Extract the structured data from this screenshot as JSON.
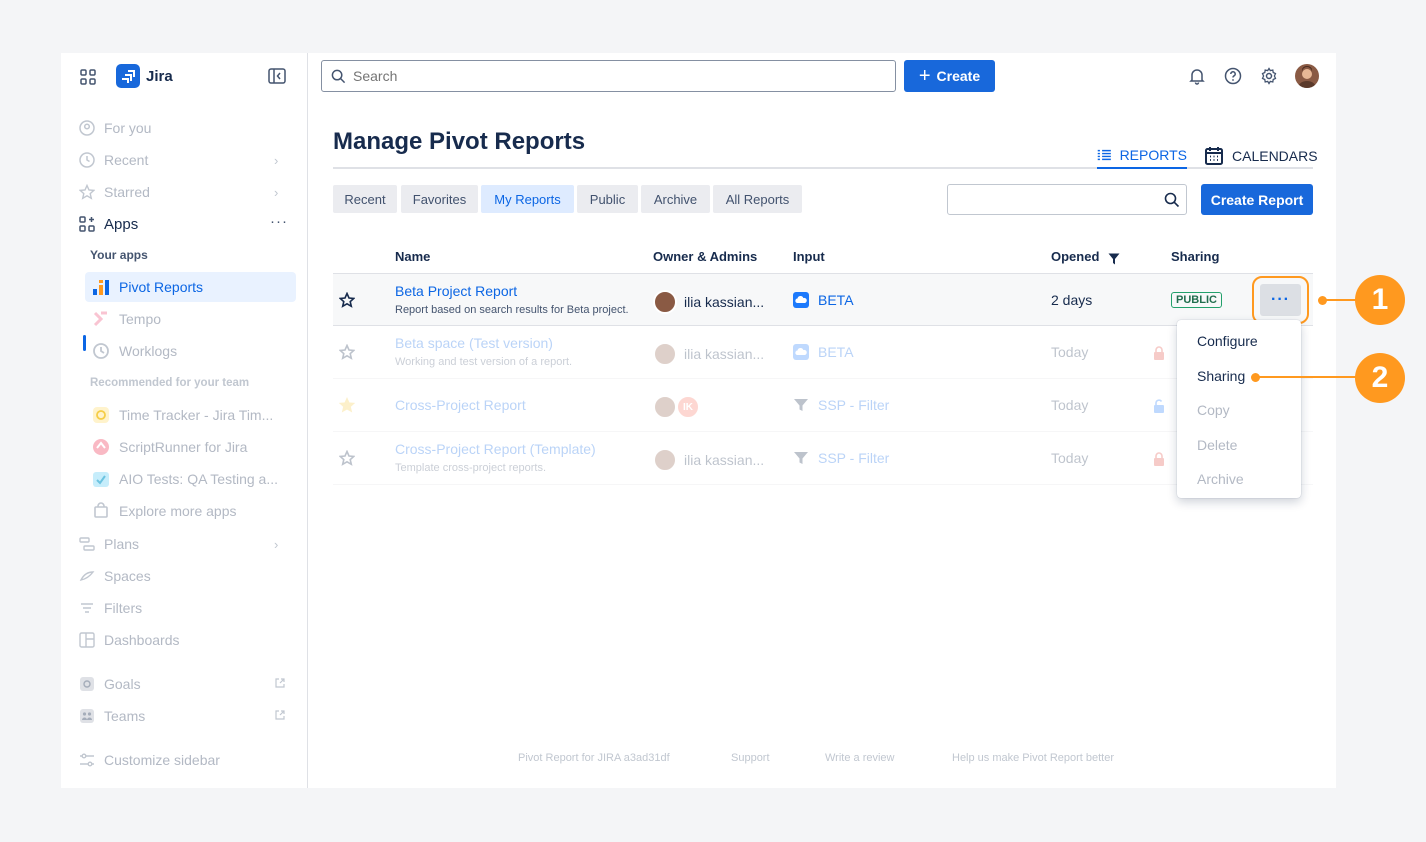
{
  "sidebar": {
    "app_name": "Jira",
    "items": {
      "for_you": "For you",
      "recent": "Recent",
      "starred": "Starred",
      "apps": "Apps",
      "plans": "Plans",
      "spaces": "Spaces",
      "filters": "Filters",
      "dashboards": "Dashboards",
      "goals": "Goals",
      "teams": "Teams",
      "customize": "Customize sidebar"
    },
    "apps_more": "···",
    "your_apps_heading": "Your apps",
    "your_apps": [
      "Pivot Reports",
      "Tempo",
      "Worklogs"
    ],
    "recommended_heading": "Recommended for your team",
    "recommended": [
      "Time Tracker - Jira Tim...",
      "ScriptRunner for Jira",
      "AIO Tests: QA Testing a...",
      "Explore more apps"
    ]
  },
  "topbar": {
    "search_placeholder": "Search",
    "create_label": "Create"
  },
  "page": {
    "title": "Manage Pivot Reports",
    "view_tabs": {
      "reports": "REPORTS",
      "calendars": "CALENDARS"
    },
    "filter_tabs": [
      "Recent",
      "Favorites",
      "My Reports",
      "Public",
      "Archive",
      "All Reports"
    ],
    "selected_filter_tab": "My Reports",
    "create_report_label": "Create Report"
  },
  "table": {
    "headers": {
      "name": "Name",
      "owner": "Owner & Admins",
      "input": "Input",
      "opened": "Opened",
      "sharing": "Sharing"
    },
    "rows": [
      {
        "name": "Beta Project Report",
        "description": "Report based on search results for Beta project.",
        "owner": "ilia kassian...",
        "input": "BETA",
        "opened": "2 days",
        "sharing": "PUBLIC",
        "starred": true
      },
      {
        "name": "Beta space (Test version)",
        "description": "Working and test version of a report.",
        "owner": "ilia kassian...",
        "input": "BETA",
        "opened": "Today",
        "sharing": "private",
        "starred": false
      },
      {
        "name": "Cross-Project Report",
        "description": "",
        "owner": "",
        "owner_initials": "IK",
        "input": "SSP - Filter",
        "opened": "Today",
        "sharing": "restricted",
        "starred": true
      },
      {
        "name": "Cross-Project Report (Template)",
        "description": "Template cross-project reports.",
        "owner": "ilia kassian...",
        "input": "SSP - Filter",
        "opened": "Today",
        "sharing": "private",
        "starred": false
      }
    ]
  },
  "row_menu": {
    "more_label": "···",
    "items": [
      "Configure",
      "Sharing",
      "Copy",
      "Delete",
      "Archive"
    ],
    "enabled": [
      "Configure",
      "Sharing"
    ]
  },
  "footer": {
    "version": "Pivot Report for JIRA a3ad31df",
    "support": "Support",
    "review": "Write a review",
    "feedback": "Help us make Pivot Report better"
  },
  "callouts": [
    "1",
    "2"
  ],
  "colors": {
    "accent": "#1868db",
    "callout": "#ff991f",
    "public_badge": "#22a06b"
  }
}
